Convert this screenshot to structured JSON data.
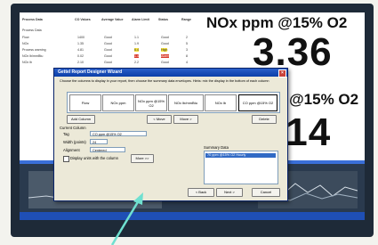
{
  "dialog": {
    "title": "Gettel Report Designer Wizard",
    "instructions": "Choose the columns to display in your report, then choose the summary data envelopes. Hints: mix the display in the bottom of each column",
    "columns": [
      "Flow",
      "NOx ppm",
      "NOx ppm @15% O2",
      "NOx lb/mmBtu",
      "NOx lb",
      "CO ppm @15% O2"
    ],
    "add_column": "Add Column",
    "move_left": "< Move",
    "move_right": "Move >",
    "delete": "Delete",
    "current_column_label": "Current Column",
    "tag_label": "Tag",
    "tag_value": "CO ppm @15% O2",
    "width_label": "Width (points)",
    "width_value": "24",
    "alignment_label": "Alignment",
    "alignment_value": "Centered",
    "display_checkbox": "Display units with the column",
    "more_button": "More >>",
    "summary_label": "Summary Data",
    "summary_selected": "70 ppm @15% O2 Hourly",
    "back_button": "< Back",
    "next_button": "Next >",
    "cancel_button": "Cancel"
  },
  "readouts": {
    "top_title": "NOx ppm @15% O2",
    "top_value": "3.36",
    "bottom_title": "n @15% O2",
    "bottom_value": ".14"
  },
  "table": {
    "headers": [
      "Process Data",
      "CO Values",
      "Average Value",
      "Alarm Limit",
      "Status",
      "Range"
    ],
    "rows": [
      [
        "Process Data",
        "",
        "",
        "",
        "",
        ""
      ],
      [
        "Flow",
        "1400",
        "Good",
        "1.1",
        "Good",
        "2"
      ],
      [
        "NOx",
        "1.35",
        "Good",
        "1.9",
        "Good",
        "5"
      ],
      [
        "Process warning",
        "4.81",
        "Good",
        "6.4",
        "High",
        "3"
      ],
      [
        "NOx lb/mmBtu",
        "0.02",
        "Good",
        "1.4",
        "Alarm",
        "8"
      ],
      [
        "NOx lb",
        "2.10",
        "Good",
        "2.2",
        "Good",
        "4"
      ]
    ]
  },
  "colors": {
    "dialog_title_bar": "#0b3ea8",
    "selection": "#316ac5",
    "highlight_yellow": "#f5e23b",
    "highlight_red": "#d83a2a"
  }
}
